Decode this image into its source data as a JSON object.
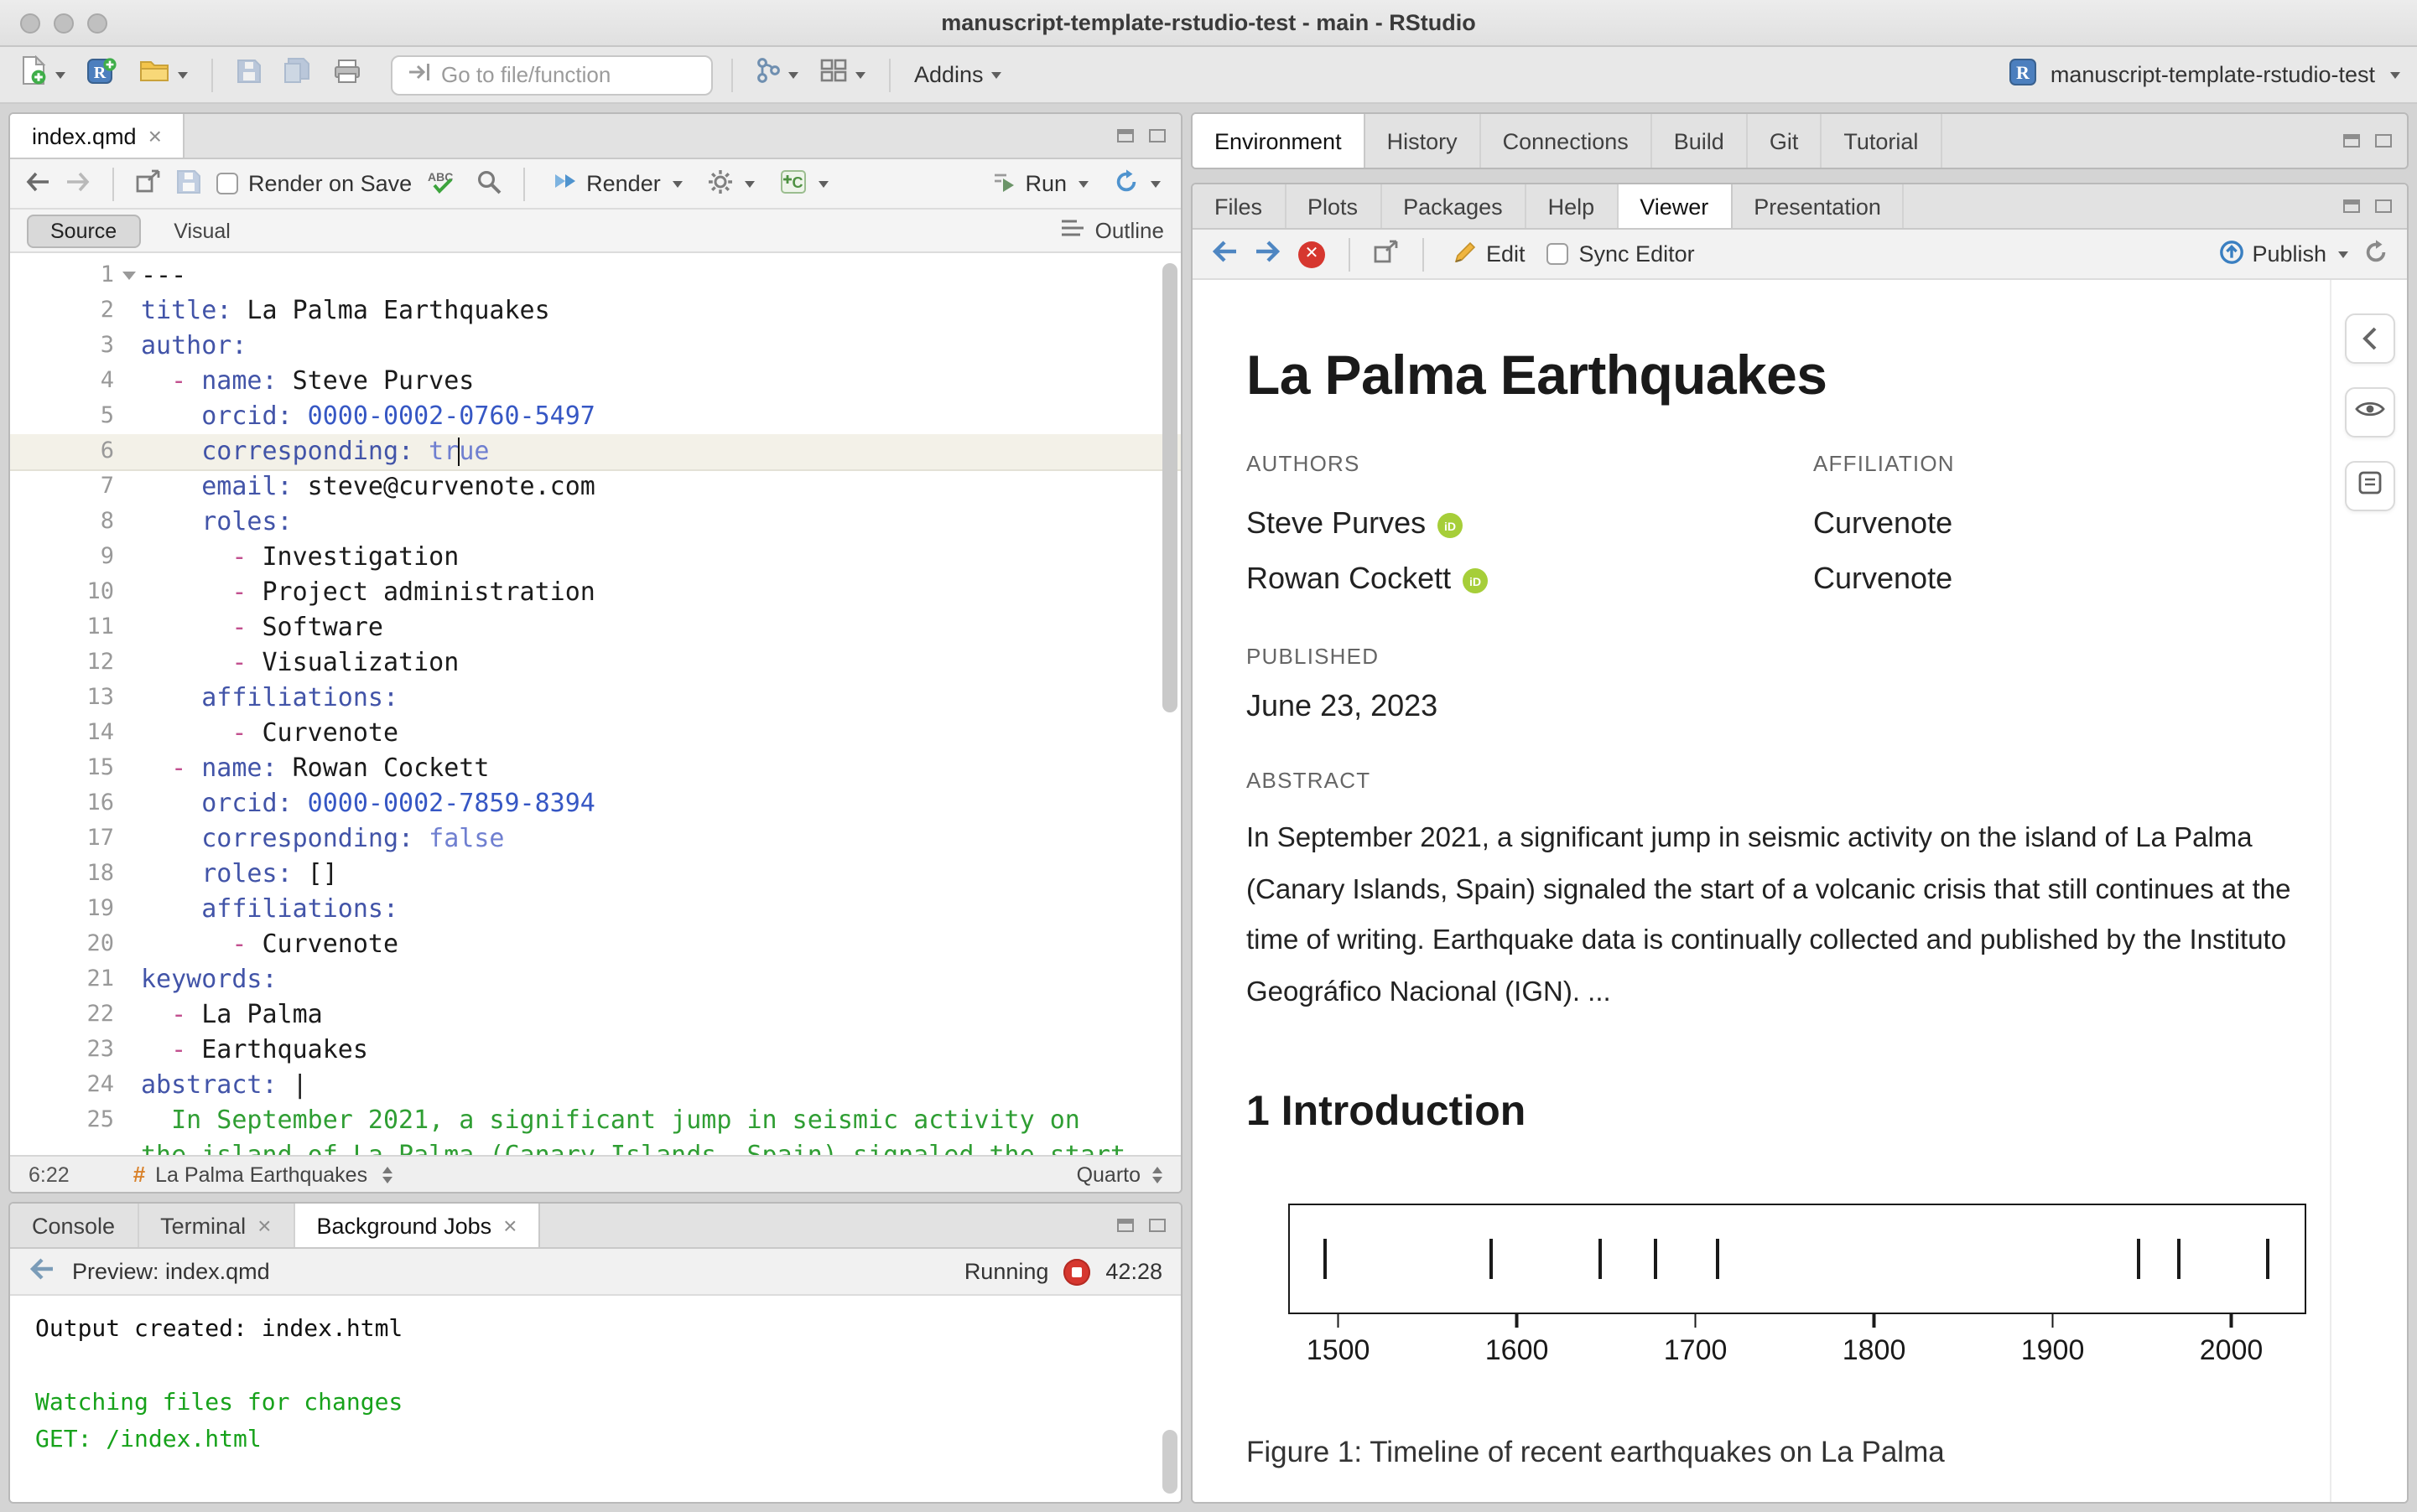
{
  "window": {
    "title": "manuscript-template-rstudio-test - main - RStudio"
  },
  "main_toolbar": {
    "goto_placeholder": "Go to file/function",
    "addins_label": "Addins",
    "project_label": "manuscript-template-rstudio-test"
  },
  "source_pane": {
    "tab_label": "index.qmd",
    "toolbar": {
      "render_on_save_label": "Render on Save",
      "render_label": "Render",
      "run_label": "Run"
    },
    "mode_source": "Source",
    "mode_visual": "Visual",
    "outline_label": "Outline",
    "status": {
      "position": "6:22",
      "section": "La Palma Earthquakes",
      "format": "Quarto"
    }
  },
  "editor": {
    "active_line": "6",
    "lines": [
      {
        "num": "1",
        "fold": true,
        "segs": [
          [
            "plain",
            "---"
          ]
        ]
      },
      {
        "num": "2",
        "segs": [
          [
            "key",
            "title:"
          ],
          [
            "plain",
            " La Palma Earthquakes"
          ]
        ]
      },
      {
        "num": "3",
        "segs": [
          [
            "key",
            "author:"
          ]
        ]
      },
      {
        "num": "4",
        "segs": [
          [
            "plain",
            "  "
          ],
          [
            "dash",
            "- "
          ],
          [
            "key",
            "name:"
          ],
          [
            "plain",
            " Steve Purves"
          ]
        ]
      },
      {
        "num": "5",
        "segs": [
          [
            "plain",
            "    "
          ],
          [
            "key",
            "orcid:"
          ],
          [
            "num2",
            " 0000-0002-0760-5497"
          ]
        ]
      },
      {
        "num": "6",
        "segs": [
          [
            "plain",
            "    "
          ],
          [
            "key",
            "corresponding:"
          ],
          [
            "bool",
            " tr"
          ],
          [
            "cursor",
            ""
          ],
          [
            "bool",
            "ue"
          ]
        ]
      },
      {
        "num": "7",
        "segs": [
          [
            "plain",
            "    "
          ],
          [
            "key",
            "email:"
          ],
          [
            "plain",
            " steve@curvenote.com"
          ]
        ]
      },
      {
        "num": "8",
        "segs": [
          [
            "plain",
            "    "
          ],
          [
            "key",
            "roles:"
          ]
        ]
      },
      {
        "num": "9",
        "segs": [
          [
            "plain",
            "      "
          ],
          [
            "dash",
            "- "
          ],
          [
            "plain",
            "Investigation"
          ]
        ]
      },
      {
        "num": "10",
        "segs": [
          [
            "plain",
            "      "
          ],
          [
            "dash",
            "- "
          ],
          [
            "plain",
            "Project administration"
          ]
        ]
      },
      {
        "num": "11",
        "segs": [
          [
            "plain",
            "      "
          ],
          [
            "dash",
            "- "
          ],
          [
            "plain",
            "Software"
          ]
        ]
      },
      {
        "num": "12",
        "segs": [
          [
            "plain",
            "      "
          ],
          [
            "dash",
            "- "
          ],
          [
            "plain",
            "Visualization"
          ]
        ]
      },
      {
        "num": "13",
        "segs": [
          [
            "plain",
            "    "
          ],
          [
            "key",
            "affiliations:"
          ]
        ]
      },
      {
        "num": "14",
        "segs": [
          [
            "plain",
            "      "
          ],
          [
            "dash",
            "- "
          ],
          [
            "plain",
            "Curvenote"
          ]
        ]
      },
      {
        "num": "15",
        "segs": [
          [
            "plain",
            "  "
          ],
          [
            "dash",
            "- "
          ],
          [
            "key",
            "name:"
          ],
          [
            "plain",
            " Rowan Cockett"
          ]
        ]
      },
      {
        "num": "16",
        "segs": [
          [
            "plain",
            "    "
          ],
          [
            "key",
            "orcid:"
          ],
          [
            "num2",
            " 0000-0002-7859-8394"
          ]
        ]
      },
      {
        "num": "17",
        "segs": [
          [
            "plain",
            "    "
          ],
          [
            "key",
            "corresponding:"
          ],
          [
            "bool",
            " false"
          ]
        ]
      },
      {
        "num": "18",
        "segs": [
          [
            "plain",
            "    "
          ],
          [
            "key",
            "roles:"
          ],
          [
            "plain",
            " []"
          ]
        ]
      },
      {
        "num": "19",
        "segs": [
          [
            "plain",
            "    "
          ],
          [
            "key",
            "affiliations:"
          ]
        ]
      },
      {
        "num": "20",
        "segs": [
          [
            "plain",
            "      "
          ],
          [
            "dash",
            "- "
          ],
          [
            "plain",
            "Curvenote"
          ]
        ]
      },
      {
        "num": "21",
        "segs": [
          [
            "key",
            "keywords:"
          ]
        ]
      },
      {
        "num": "22",
        "segs": [
          [
            "plain",
            "  "
          ],
          [
            "dash",
            "- "
          ],
          [
            "plain",
            "La Palma"
          ]
        ]
      },
      {
        "num": "23",
        "segs": [
          [
            "plain",
            "  "
          ],
          [
            "dash",
            "- "
          ],
          [
            "plain",
            "Earthquakes"
          ]
        ]
      },
      {
        "num": "24",
        "segs": [
          [
            "key",
            "abstract:"
          ],
          [
            "plain",
            " |"
          ]
        ]
      },
      {
        "num": "25",
        "segs": [
          [
            "green",
            "  In September 2021, a significant jump in seismic activity on"
          ]
        ]
      },
      {
        "num": "",
        "segs": [
          [
            "green",
            "the island of La Palma (Canary Islands, Spain) signaled the start"
          ]
        ]
      }
    ]
  },
  "console_pane": {
    "active_tab": "Background Jobs",
    "tabs": [
      {
        "label": "Console",
        "closable": false
      },
      {
        "label": "Terminal",
        "closable": true
      },
      {
        "label": "Background Jobs",
        "closable": true
      }
    ],
    "preview": {
      "label": "Preview: index.qmd",
      "status": "Running",
      "timer": "42:28"
    },
    "output": [
      {
        "text": "Output created: index.html",
        "color": "plain"
      },
      {
        "text": "",
        "color": "plain"
      },
      {
        "text": "Watching files for changes",
        "color": "green"
      },
      {
        "text": "GET: /index.html",
        "color": "green"
      }
    ]
  },
  "workspace_pane": {
    "active_tab": "Environment",
    "tabs": [
      "Environment",
      "History",
      "Connections",
      "Build",
      "Git",
      "Tutorial"
    ]
  },
  "viewer_pane": {
    "active_tab": "Viewer",
    "tabs": [
      "Files",
      "Plots",
      "Packages",
      "Help",
      "Viewer",
      "Presentation"
    ],
    "toolbar": {
      "edit_label": "Edit",
      "sync_label": "Sync Editor",
      "publish_label": "Publish"
    }
  },
  "article": {
    "title": "La Palma Earthquakes",
    "authors_label": "AUTHORS",
    "affiliation_label": "AFFILIATION",
    "authors": [
      {
        "name": "Steve Purves",
        "affiliation": "Curvenote"
      },
      {
        "name": "Rowan Cockett",
        "affiliation": "Curvenote"
      }
    ],
    "published_label": "PUBLISHED",
    "published_date": "June 23, 2023",
    "abstract_label": "ABSTRACT",
    "abstract_text": "In September 2021, a significant jump in seismic activity on the island of La Palma (Canary Islands, Spain) signaled the start of a volcanic crisis that still continues at the time of writing. Earthquake data is continually collected and published by the Instituto Geográfico Nacional (IGN). ...",
    "section_heading": "1 Introduction"
  },
  "chart_data": {
    "type": "rug-timeline",
    "x_values": [
      1492,
      1585,
      1646,
      1677,
      1712,
      1949,
      1971,
      2021
    ],
    "xticks": [
      1500,
      1600,
      1700,
      1800,
      1900,
      2000
    ],
    "xlim": [
      1472,
      2042
    ],
    "xlabel": "",
    "ylabel": "",
    "caption": "Figure 1: Timeline of recent earthquakes on La Palma"
  },
  "syntax_colors": {
    "plain": "#1b1b1b",
    "key": "#4254a8",
    "num2": "#3657c4",
    "bool": "#6f7fd0",
    "dash": "#c2508f",
    "green": "#2f9e33"
  },
  "colors": {
    "accent_blue": "#4c8dce",
    "orcid_green": "#A6CE39",
    "console_green": "#17a21b",
    "stop_red": "#d6372f"
  }
}
